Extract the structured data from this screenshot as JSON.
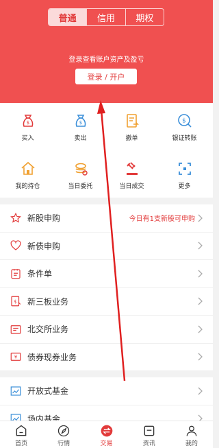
{
  "segments": [
    "普通",
    "信用",
    "期权"
  ],
  "login_tip": "登录查看账户资产及盈亏",
  "login_button": "登录 / 开户",
  "grid": [
    {
      "label": "买入",
      "icon": "buy-icon"
    },
    {
      "label": "卖出",
      "icon": "sell-icon"
    },
    {
      "label": "撤单",
      "icon": "cancel-order-icon"
    },
    {
      "label": "银证转账",
      "icon": "bank-transfer-icon"
    },
    {
      "label": "我的持仓",
      "icon": "holdings-icon"
    },
    {
      "label": "当日委托",
      "icon": "today-orders-icon"
    },
    {
      "label": "当日成交",
      "icon": "today-trades-icon"
    },
    {
      "label": "更多",
      "icon": "more-icon"
    }
  ],
  "list": [
    {
      "label": "新股申购",
      "hint": "今日有1支新股可申购",
      "icon": "star-icon"
    },
    {
      "label": "新债申购",
      "hint": "",
      "icon": "heart-icon"
    },
    {
      "label": "条件单",
      "hint": "",
      "icon": "condition-icon"
    },
    {
      "label": "新三板业务",
      "hint": "",
      "icon": "neeq-icon"
    },
    {
      "label": "北交所业务",
      "hint": "",
      "icon": "bse-icon"
    },
    {
      "label": "债券现券业务",
      "hint": "",
      "icon": "bond-icon"
    }
  ],
  "list2": [
    {
      "label": "开放式基金",
      "icon": "fund-icon"
    },
    {
      "label": "场内基金",
      "icon": "exchange-fund-icon"
    }
  ],
  "tabs": [
    {
      "label": "首页",
      "icon": "home-icon"
    },
    {
      "label": "行情",
      "icon": "market-icon"
    },
    {
      "label": "交易",
      "icon": "trade-icon"
    },
    {
      "label": "资讯",
      "icon": "news-icon"
    },
    {
      "label": "我的",
      "icon": "profile-icon"
    }
  ],
  "colors": {
    "accent": "#f05050",
    "text": "#333333",
    "icon_blue": "#3b8fd9",
    "icon_orange": "#f0a030"
  }
}
